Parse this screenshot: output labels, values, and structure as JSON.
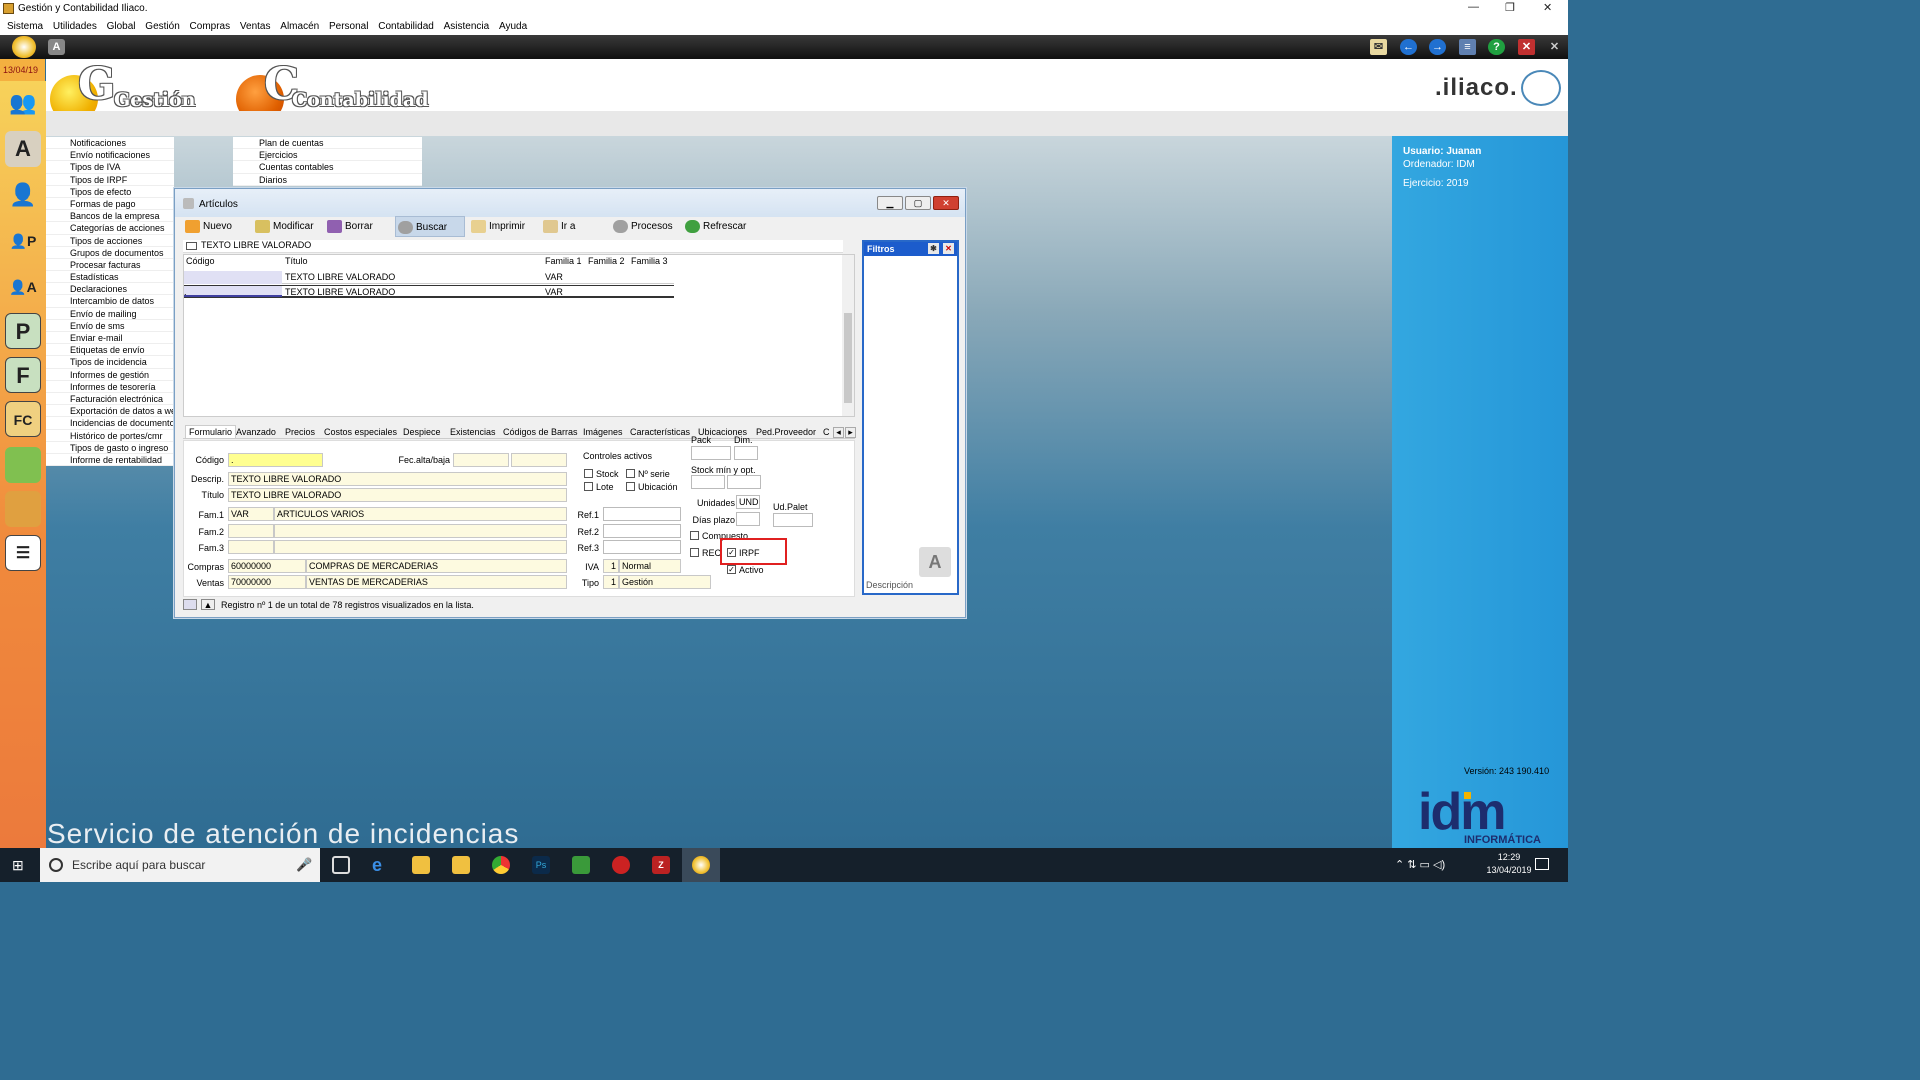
{
  "window": {
    "title": "Gestión y Contabilidad Iliaco."
  },
  "menubar": [
    "Sistema",
    "Utilidades",
    "Global",
    "Gestión",
    "Compras",
    "Ventas",
    "Almacén",
    "Personal",
    "Contabilidad",
    "Asistencia",
    "Ayuda"
  ],
  "date": "13/04/19",
  "header": {
    "logo1": "Gestión",
    "logo2": "Contabilidad",
    "brand": ".iliaco."
  },
  "left_menu": [
    "Notificaciones",
    "Envío notificaciones",
    "Tipos de IVA",
    "Tipos de IRPF",
    "Tipos de efecto",
    "Formas de pago",
    "Bancos de la empresa",
    "Categorías de acciones",
    "Tipos de acciones",
    "Grupos de documentos",
    "Procesar facturas",
    "Estadísticas",
    "Declaraciones",
    "Intercambio de datos",
    "Envío de mailing",
    "Envío de sms",
    "Enviar e-mail",
    "Etiquetas de envío",
    "Tipos de incidencia",
    "Informes de gestión",
    "Informes de tesorería",
    "Facturación electrónica",
    "Exportación de datos a we",
    "Incidencias de documentos",
    "Histórico de portes/cmr",
    "Tipos de gasto o ingreso",
    "Informe de rentabilidad"
  ],
  "mid_menu": [
    "Plan de cuentas",
    "Ejercicios",
    "Cuentas contables",
    "Diarios"
  ],
  "user": {
    "usuario": "Usuario: Juanan",
    "ordenador": "Ordenador: IDM",
    "ejercicio": "Ejercicio: 2019"
  },
  "version": "Versión: 243 190.410",
  "idm": {
    "big": "idm",
    "small": "INFORMÁTICA"
  },
  "servicio": "Servicio de atención de incidencias",
  "dialog": {
    "title": "Artículos",
    "toolbar": [
      "Nuevo",
      "Modificar",
      "Borrar",
      "Buscar",
      "Imprimir",
      "Ir a",
      "Procesos",
      "Refrescar"
    ],
    "search": "TEXTO LIBRE VALORADO",
    "grid_headers": [
      "Código",
      "Título",
      "Familia 1",
      "Familia 2",
      "Familia 3"
    ],
    "rows": [
      {
        "codigo": "",
        "titulo": "TEXTO LIBRE VALORADO",
        "fam1": "VAR"
      },
      {
        "codigo": ".",
        "titulo": "TEXTO LIBRE VALORADO",
        "fam1": "VAR"
      }
    ],
    "filtros": "Filtros",
    "tabs": [
      "Formulario",
      "Avanzado",
      "Precios",
      "Costos especiales",
      "Despiece",
      "Existencias",
      "Códigos de Barras",
      "Imágenes",
      "Características",
      "Ubicaciones",
      "Ped.Proveedor",
      "C"
    ],
    "form": {
      "codigo_label": "Código",
      "codigo": ".",
      "fecalta_label": "Fec.alta/baja",
      "descrip_label": "Descrip.",
      "descrip": "TEXTO LIBRE VALORADO",
      "titulo_label": "Título",
      "titulo": "TEXTO LIBRE VALORADO",
      "fam1_label": "Fam.1",
      "fam1_code": "VAR",
      "fam1_name": "ARTICULOS VARIOS",
      "fam2_label": "Fam.2",
      "fam3_label": "Fam.3",
      "compras_label": "Compras",
      "compras_code": "60000000",
      "compras_name": "COMPRAS DE MERCADERIAS",
      "ventas_label": "Ventas",
      "ventas_code": "70000000",
      "ventas_name": "VENTAS DE MERCADERIAS",
      "controles": "Controles activos",
      "stock": "Stock",
      "nserie": "Nº serie",
      "lote": "Lote",
      "ubicacion": "Ubicación",
      "ref1": "Ref.1",
      "ref2": "Ref.2",
      "ref3": "Ref.3",
      "iva_label": "IVA",
      "iva_num": "1",
      "iva_name": "Normal",
      "tipo_label": "Tipo",
      "tipo_num": "1",
      "tipo_name": "Gestión",
      "pack": "Pack",
      "dim": "Dim.",
      "stockmin": "Stock mín y opt.",
      "unidades_label": "Unidades",
      "unidades": "UND",
      "udpalet": "Ud.Palet",
      "diasplazo": "Días plazo",
      "compuesto": "Compuesto",
      "rec": "REC",
      "irpf": "IRPF",
      "activo": "Activo",
      "descripcion": "Descripción"
    },
    "status": "Registro nº 1 de un total de 78 registros visualizados en la lista."
  },
  "taskbar": {
    "search_placeholder": "Escribe aquí para buscar",
    "time": "12:29",
    "date": "13/04/2019"
  }
}
